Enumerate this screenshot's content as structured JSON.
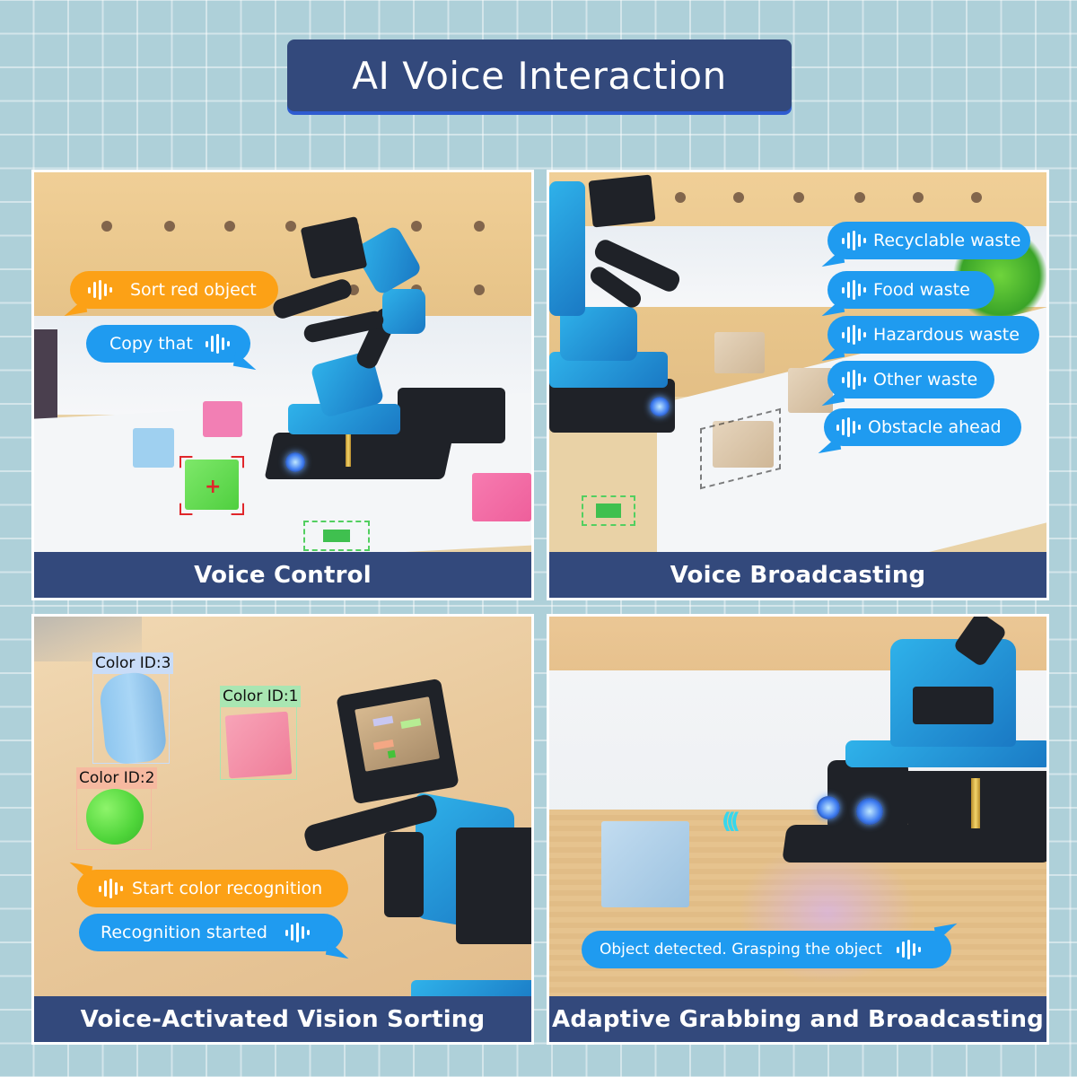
{
  "title": "AI Voice Interaction",
  "colors": {
    "banner": "#33497c",
    "banner_shadow": "#2e5bd0",
    "background": "#aed0d9",
    "bubble_orange": "#fca116",
    "bubble_blue": "#1f9bf0",
    "robot_blue": "#1f8fd6"
  },
  "panels": [
    {
      "caption": "Voice Control",
      "bubbles": [
        {
          "text": "Sort red object",
          "color": "orange",
          "icon": "voice-wave-icon"
        },
        {
          "text": "Copy that",
          "color": "blue",
          "icon": "voice-wave-icon"
        }
      ]
    },
    {
      "caption": "Voice Broadcasting",
      "bubbles": [
        {
          "text": "Recyclable waste",
          "color": "blue",
          "icon": "voice-wave-icon"
        },
        {
          "text": "Food waste",
          "color": "blue",
          "icon": "voice-wave-icon"
        },
        {
          "text": "Hazardous waste",
          "color": "blue",
          "icon": "voice-wave-icon"
        },
        {
          "text": "Other waste",
          "color": "blue",
          "icon": "voice-wave-icon"
        },
        {
          "text": "Obstacle ahead",
          "color": "blue",
          "icon": "voice-wave-icon"
        }
      ]
    },
    {
      "caption": "Voice-Activated Vision Sorting",
      "detections": [
        {
          "label": "Color ID:3",
          "object": "blue cylinder",
          "label_color": "#c9dcf7"
        },
        {
          "label": "Color ID:1",
          "object": "pink cube",
          "label_color": "#a9e6b2"
        },
        {
          "label": "Color ID:2",
          "object": "green ball",
          "label_color": "#f6b9a0"
        }
      ],
      "bubbles": [
        {
          "text": "Start color recognition",
          "color": "orange",
          "icon": "voice-wave-icon"
        },
        {
          "text": "Recognition started",
          "color": "blue",
          "icon": "voice-wave-icon"
        }
      ]
    },
    {
      "caption": "Adaptive Grabbing and Broadcasting",
      "bubbles": [
        {
          "text": "Object detected. Grasping the object",
          "color": "blue",
          "icon": "voice-wave-icon"
        }
      ]
    }
  ]
}
